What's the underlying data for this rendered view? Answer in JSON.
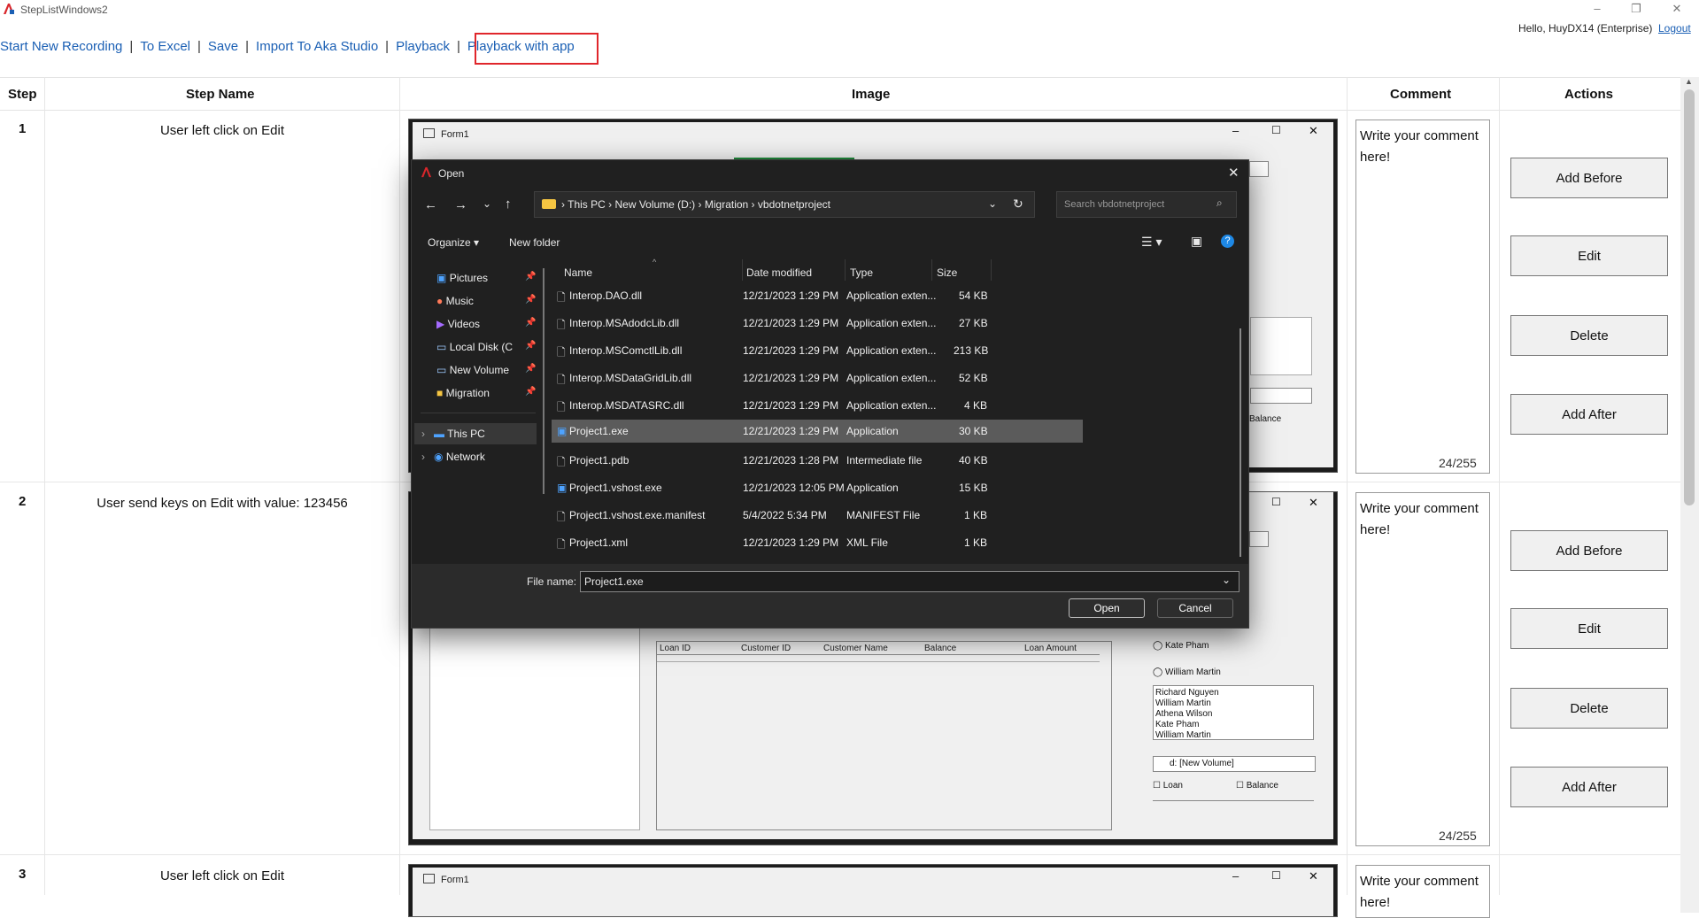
{
  "window": {
    "title": "StepListWindows2",
    "minimize_icon": "minimize-icon",
    "restore_icon": "restore-icon",
    "close_icon": "close-icon"
  },
  "toolbar": {
    "start_new_recording": "Start New Recording",
    "to_excel": "To Excel",
    "save": "Save",
    "import_to_aka": "Import To Aka Studio",
    "playback": "Playback",
    "playback_with_app": "Playback with app",
    "separator": "|"
  },
  "user": {
    "greeting": "Hello, HuyDX14 (Enterprise)",
    "logout": "Logout"
  },
  "table": {
    "headers": {
      "step": "Step",
      "step_name": "Step Name",
      "image": "Image",
      "comment": "Comment",
      "actions": "Actions"
    },
    "rows": [
      {
        "step": "1",
        "name": "User left click on Edit",
        "comment": "Write your comment here!",
        "counter": "24/255"
      },
      {
        "step": "2",
        "name": "User send keys on Edit with value: 123456",
        "comment": "Write your comment here!",
        "counter": "24/255"
      },
      {
        "step": "3",
        "name": "User left click on Edit",
        "comment": "Write your comment here!",
        "counter": ""
      }
    ],
    "actions": {
      "add_before": "Add Before",
      "edit": "Edit",
      "delete": "Delete",
      "add_after": "Add After"
    }
  },
  "screenshot_form": {
    "title": "Form1",
    "grid_headers": [
      "Loan ID",
      "Customer ID",
      "Customer Name",
      "Balance",
      "Loan Amount"
    ],
    "radio1": "Kate Pham",
    "radio2": "William Martin",
    "list_items": [
      "Richard Nguyen",
      "William Martin",
      "Athena Wilson",
      "Kate Pham",
      "William Martin"
    ],
    "drive": "d: [New Volume]",
    "check_loan": "Loan",
    "check_balance": "Balance",
    "partial_balance": "Balance"
  },
  "dialog": {
    "title": "Open",
    "breadcrumb": [
      "This PC",
      "New Volume (D:)",
      "Migration",
      "vbdotnetproject"
    ],
    "search_placeholder": "Search vbdotnetproject",
    "organize": "Organize",
    "new_folder": "New folder",
    "nav": [
      {
        "label": "Pictures",
        "icon": "pictures-icon"
      },
      {
        "label": "Music",
        "icon": "music-icon"
      },
      {
        "label": "Videos",
        "icon": "videos-icon"
      },
      {
        "label": "Local Disk (C",
        "icon": "disk-icon"
      },
      {
        "label": "New Volume",
        "icon": "disk-icon"
      },
      {
        "label": "Migration",
        "icon": "folder-icon"
      },
      {
        "label": "This PC",
        "icon": "pc-icon"
      },
      {
        "label": "Network",
        "icon": "network-icon"
      }
    ],
    "columns": {
      "name": "Name",
      "date": "Date modified",
      "type": "Type",
      "size": "Size"
    },
    "files": [
      {
        "name": "Interop.DAO.dll",
        "date": "12/21/2023 1:29 PM",
        "type": "Application exten...",
        "size": "54 KB"
      },
      {
        "name": "Interop.MSAdodcLib.dll",
        "date": "12/21/2023 1:29 PM",
        "type": "Application exten...",
        "size": "27 KB"
      },
      {
        "name": "Interop.MSComctlLib.dll",
        "date": "12/21/2023 1:29 PM",
        "type": "Application exten...",
        "size": "213 KB"
      },
      {
        "name": "Interop.MSDataGridLib.dll",
        "date": "12/21/2023 1:29 PM",
        "type": "Application exten...",
        "size": "52 KB"
      },
      {
        "name": "Interop.MSDATASRC.dll",
        "date": "12/21/2023 1:29 PM",
        "type": "Application exten...",
        "size": "4 KB"
      },
      {
        "name": "Project1.exe",
        "date": "12/21/2023 1:29 PM",
        "type": "Application",
        "size": "30 KB"
      },
      {
        "name": "Project1.pdb",
        "date": "12/21/2023 1:28 PM",
        "type": "Intermediate file",
        "size": "40 KB"
      },
      {
        "name": "Project1.vshost.exe",
        "date": "12/21/2023 12:05 PM",
        "type": "Application",
        "size": "15 KB"
      },
      {
        "name": "Project1.vshost.exe.manifest",
        "date": "5/4/2022 5:34 PM",
        "type": "MANIFEST File",
        "size": "1 KB"
      },
      {
        "name": "Project1.xml",
        "date": "12/21/2023 1:29 PM",
        "type": "XML File",
        "size": "1 KB"
      }
    ],
    "selected_file": "Project1.exe",
    "file_name_label": "File name:",
    "file_name_value": "Project1.exe",
    "open_button": "Open",
    "cancel_button": "Cancel"
  },
  "colors": {
    "link": "#1a5fb4",
    "highlight_border": "#e0262b",
    "dialog_bg": "#202020",
    "selected_row": "#5b5b5b"
  }
}
